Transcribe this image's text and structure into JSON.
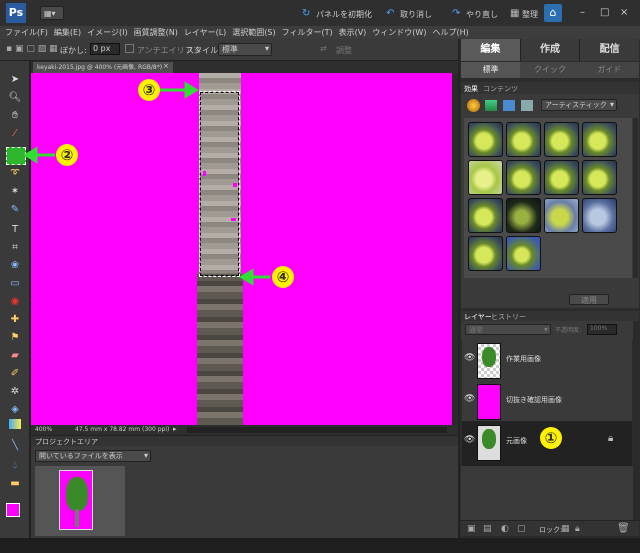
{
  "top_toolbar": {
    "reset_panels": "パネルを初期化",
    "undo": "取り消し",
    "redo": "やり直し",
    "organize": "整理"
  },
  "menu": [
    "ファイル(F)",
    "編集(E)",
    "イメージ(I)",
    "画質調整(N)",
    "レイヤー(L)",
    "選択範囲(S)",
    "フィルター(T)",
    "表示(V)",
    "ウィンドウ(W)",
    "ヘルプ(H)"
  ],
  "options_bar": {
    "feather_label": "ぼかし:",
    "feather_value": "0 px",
    "antialias_label": "アンチエイリアス",
    "style_label": "スタイル:",
    "style_value": "標準",
    "refine": "調整"
  },
  "document_tab": {
    "title": "keyaki-2015.jpg @ 400% (元画像, RGB/8*)",
    "close": "×"
  },
  "status_bar": {
    "zoom": "400%",
    "dimensions": "47.5 mm x 78.82 mm (300 ppi)"
  },
  "project_area": {
    "title": "プロジェクトエリア",
    "dropdown": "開いているファイルを表示"
  },
  "mode_tabs": {
    "edit": "編集",
    "create": "作成",
    "share": "配信"
  },
  "sub_tabs": {
    "standard": "標準",
    "quick": "クイック",
    "guide": "ガイド"
  },
  "effects_panel": {
    "tab_effects": "効果",
    "tab_content": "コンテンツ",
    "dropdown": "アーティスティック",
    "apply": "適用"
  },
  "layers_panel": {
    "tab_layers": "レイヤー",
    "tab_history": "ヒストリー",
    "blend": "通常",
    "opacity_label": "不透明度:",
    "opacity_value": "100%",
    "layers": [
      {
        "name": "作業用画像"
      },
      {
        "name": "切抜き確認用画像"
      },
      {
        "name": "元画像"
      }
    ],
    "lock_label": "ロック:"
  },
  "callouts": [
    "①",
    "②",
    "③",
    "④"
  ],
  "colors": {
    "magenta": "#ff00ff",
    "callout": "#fff200",
    "arrow": "#33dd33"
  }
}
